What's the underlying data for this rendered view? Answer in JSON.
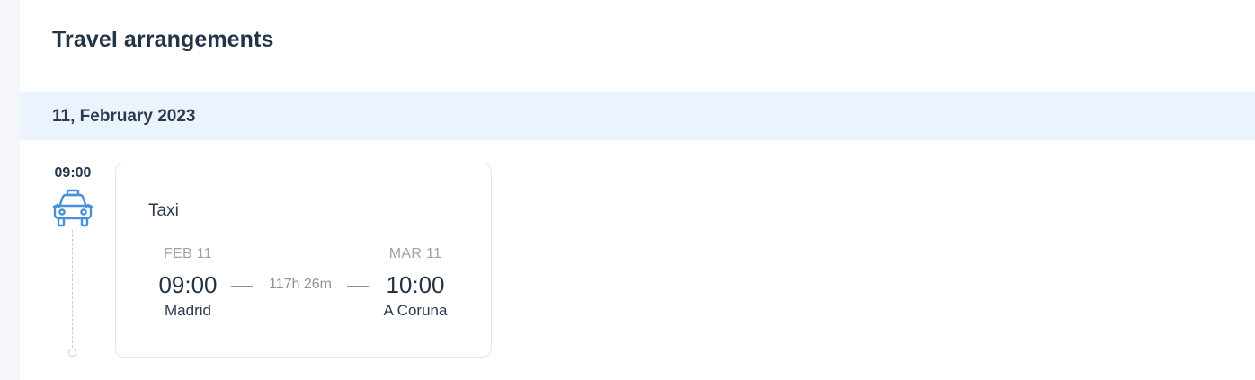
{
  "page": {
    "title": "Travel arrangements"
  },
  "day": {
    "date_label": "11, February 2023",
    "events": [
      {
        "time": "09:00",
        "icon": "taxi-icon",
        "type": "Taxi",
        "departure": {
          "date": "FEB 11",
          "time": "09:00",
          "city": "Madrid"
        },
        "duration": "117h 26m",
        "arrival": {
          "date": "MAR 11",
          "time": "10:00",
          "city": "A Coruna"
        }
      }
    ]
  },
  "colors": {
    "accent": "#4a90d9",
    "date_band": "#ebf3fd",
    "text_primary": "#243447",
    "text_muted": "#9aa3ae"
  }
}
